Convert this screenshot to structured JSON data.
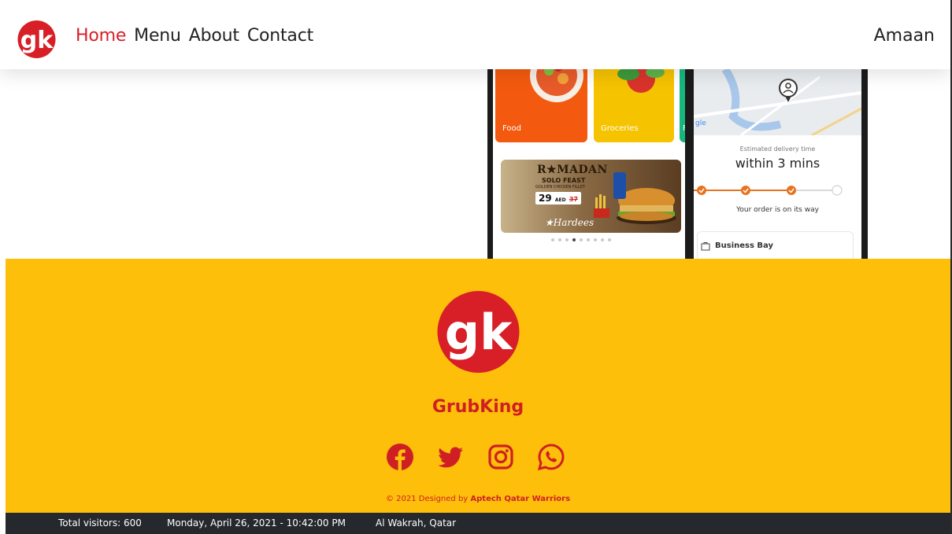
{
  "nav": {
    "logo_text": "gk",
    "links": [
      {
        "label": "Home",
        "active": true
      },
      {
        "label": "Menu",
        "active": false
      },
      {
        "label": "About",
        "active": false
      },
      {
        "label": "Contact",
        "active": false
      }
    ],
    "user": "Amaan"
  },
  "hero": {
    "phone1": {
      "categories": [
        "Food",
        "Groceries",
        "F"
      ],
      "promo": {
        "title": "R★MADAN",
        "subtitle": "SOLO FEAST",
        "subtitle2": "GOLDEN CHICKEN FILLET",
        "price": "29",
        "price_unit": "AED",
        "old_price": "37",
        "brand": "Hardees"
      }
    },
    "phone2": {
      "map_label": "gle",
      "est_label": "Estimated delivery time",
      "est_value": "within 3 mins",
      "status": "Your order is on its way",
      "address": "Business Bay"
    }
  },
  "footer": {
    "brand": "GrubKing",
    "socials": [
      "facebook-icon",
      "twitter-icon",
      "instagram-icon",
      "whatsapp-icon"
    ],
    "copyright_prefix": "© 2021 Designed by ",
    "copyright_team": "Aptech Qatar Warriors"
  },
  "status": {
    "visitors": "Total visitors: 600",
    "datetime": "Monday, April 26, 2021 - 10:42:00 PM",
    "location": "Al Wakrah, Qatar"
  },
  "colors": {
    "brand_red": "#d81e27",
    "footer_yellow": "#fdbf0a",
    "status_bar": "#25282c",
    "progress_orange": "#e8731e"
  }
}
